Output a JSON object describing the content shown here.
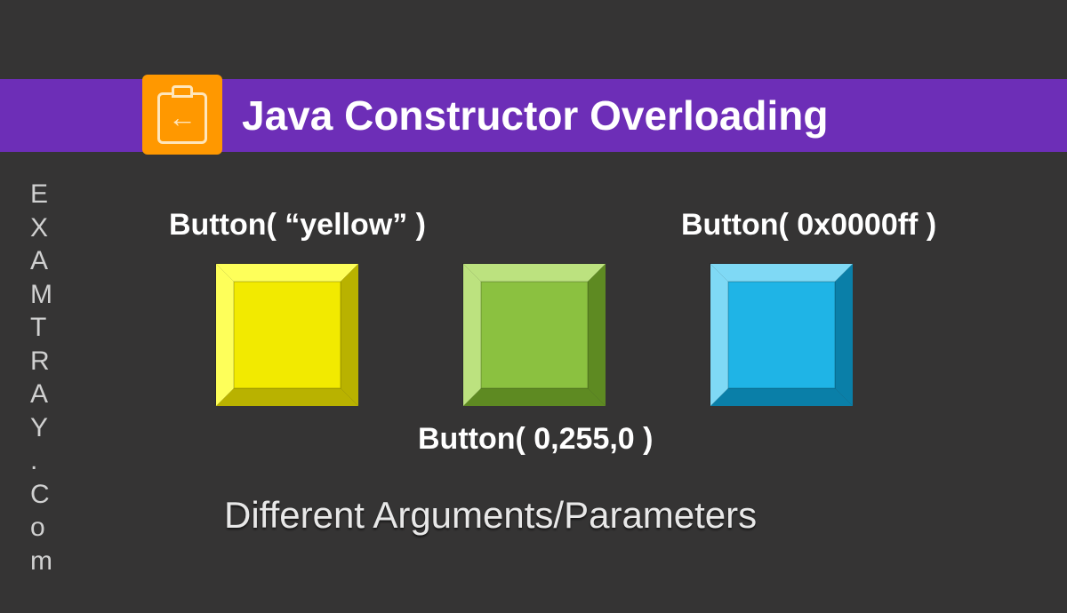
{
  "header": {
    "title": "Java Constructor Overloading"
  },
  "side_brand": "EXAMTRAY.Com",
  "labels": {
    "yellow": "Button( “yellow” )",
    "green": "Button( 0,255,0 )",
    "blue": "Button( 0x0000ff )"
  },
  "footer": "Different Arguments/Parameters",
  "buttons": {
    "yellow": {
      "base": "#f2ea00",
      "light": "#feff5a",
      "dark": "#b9b200",
      "face": "#f2ea00"
    },
    "green": {
      "base": "#8bc140",
      "light": "#bce27f",
      "dark": "#5e8a22",
      "face": "#8bc140"
    },
    "blue": {
      "base": "#1fb4e6",
      "light": "#7fd9f5",
      "dark": "#0a7fa8",
      "face": "#1fb4e6"
    }
  }
}
